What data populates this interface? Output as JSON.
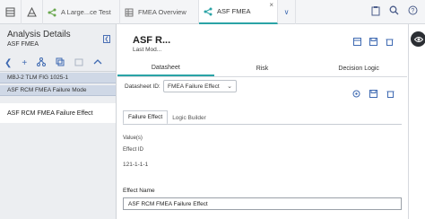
{
  "topbar": {
    "tabs": [
      {
        "label": "A Large...ce Test",
        "icon": "diagram-icon",
        "active": false
      },
      {
        "label": "FMEA Overview",
        "icon": "grid-icon",
        "active": false
      },
      {
        "label": "ASF FMEA",
        "icon": "diagram-icon",
        "active": true
      }
    ],
    "close_glyph": "×",
    "more_glyph": "∨"
  },
  "left": {
    "title": "Analysis Details",
    "subtitle": "ASF FMEA",
    "tree": [
      "MBJ-2 TLM FIG 1025-1",
      "ASF RCM FMEA Failure Mode",
      "ASF RCM FMEA Failure Effect"
    ]
  },
  "main": {
    "record_title": "ASF R...",
    "record_subtitle": "Last Mod...",
    "tabs": [
      "Datasheet",
      "Risk",
      "Decision Logic"
    ],
    "datasheet_label": "Datasheet ID:",
    "datasheet_value": "FMEA Failure Effect",
    "sub_tabs": [
      "Failure Effect",
      "Logic Builder"
    ],
    "values_label": "Value(s)",
    "effect_id_label": "Effect ID",
    "effect_id_value": "121-1-1-1",
    "effect_name_label": "Effect Name",
    "effect_name_value": "ASF RCM FMEA Failure Effect"
  },
  "colors": {
    "accent": "#2aa3a6",
    "link": "#3f6ab2",
    "tree_bg": "#cfd8e6"
  }
}
